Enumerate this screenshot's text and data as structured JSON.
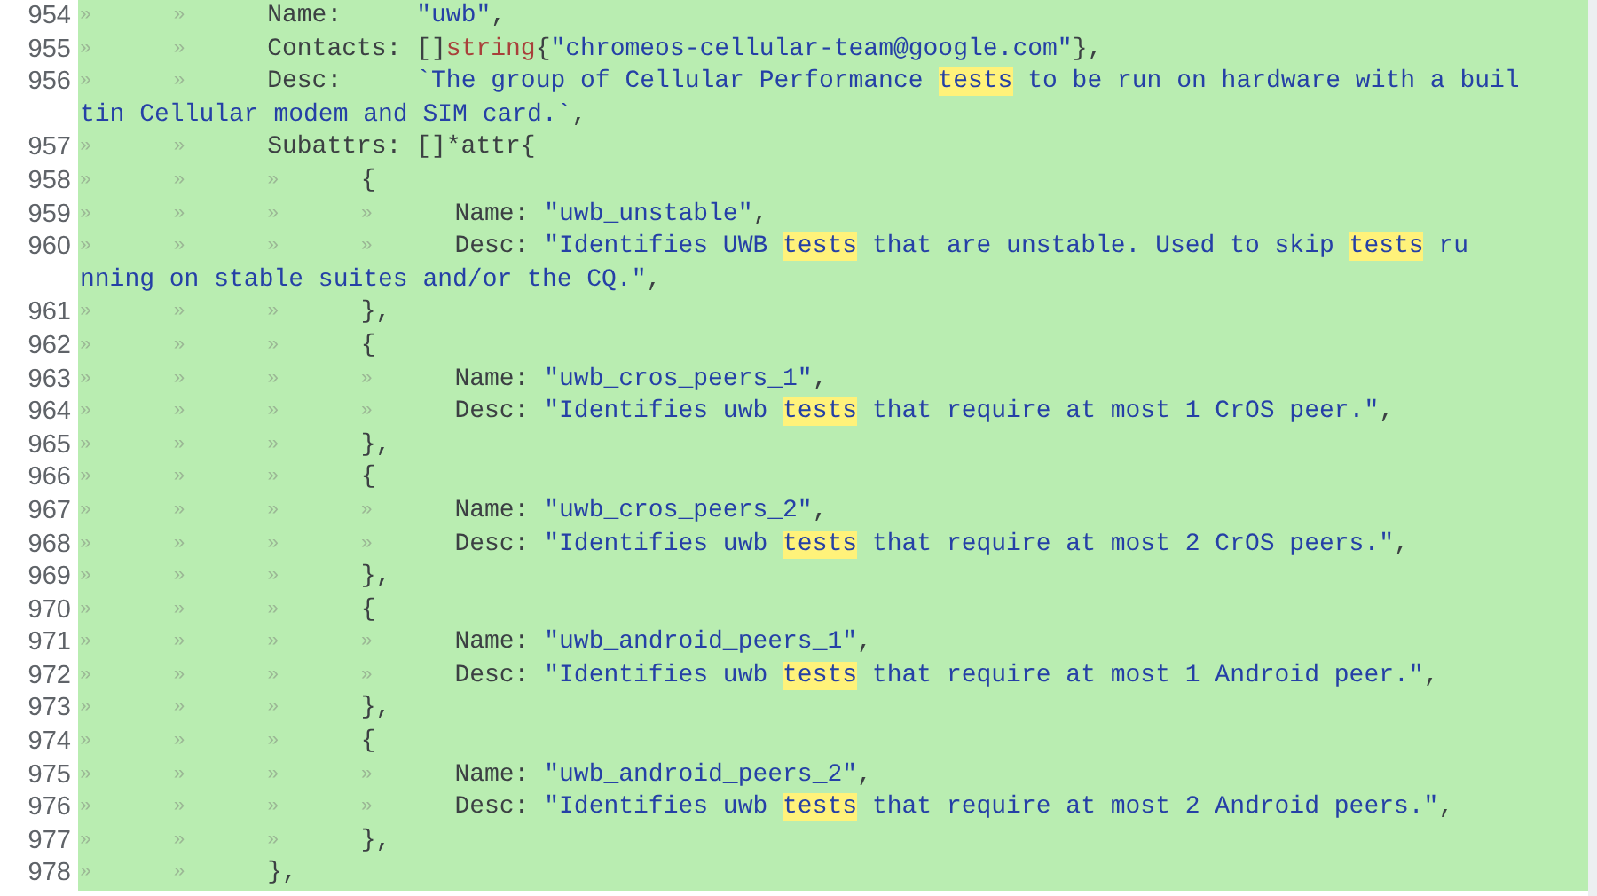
{
  "diff_lines": [
    {
      "number": "954",
      "indent": [
        "»",
        "»"
      ],
      "segments": [
        {
          "kind": "key",
          "text": "Name:     "
        },
        {
          "kind": "string",
          "text": "\"uwb\""
        },
        {
          "kind": "key",
          "text": ","
        }
      ]
    },
    {
      "number": "955",
      "indent": [
        "»",
        "»"
      ],
      "segments": [
        {
          "kind": "key",
          "text": "Contacts: []"
        },
        {
          "kind": "type",
          "text": "string"
        },
        {
          "kind": "key",
          "text": "{"
        },
        {
          "kind": "string",
          "text": "\"chromeos-cellular-team@google.com\""
        },
        {
          "kind": "key",
          "text": "},"
        }
      ]
    },
    {
      "number": "956",
      "indent": [
        "»",
        "»"
      ],
      "segments": [
        {
          "kind": "key",
          "text": "Desc:     "
        },
        {
          "kind": "string",
          "text": "`The group of Cellular Performance "
        },
        {
          "kind": "match",
          "text": "tests"
        },
        {
          "kind": "string",
          "text": " to be run on hardware with a buil"
        }
      ],
      "wrap": [
        {
          "kind": "string",
          "text": "tin Cellular modem and SIM card.`"
        },
        {
          "kind": "key",
          "text": ","
        }
      ]
    },
    {
      "number": "957",
      "indent": [
        "»",
        "»"
      ],
      "segments": [
        {
          "kind": "key",
          "text": "Subattrs: []*attr{"
        }
      ]
    },
    {
      "number": "958",
      "indent": [
        "»",
        "»",
        "»"
      ],
      "segments": [
        {
          "kind": "key",
          "text": "{"
        }
      ]
    },
    {
      "number": "959",
      "indent": [
        "»",
        "»",
        "»",
        "»"
      ],
      "segments": [
        {
          "kind": "key",
          "text": "Name: "
        },
        {
          "kind": "string",
          "text": "\"uwb_unstable\""
        },
        {
          "kind": "key",
          "text": ","
        }
      ]
    },
    {
      "number": "960",
      "indent": [
        "»",
        "»",
        "»",
        "»"
      ],
      "segments": [
        {
          "kind": "key",
          "text": "Desc: "
        },
        {
          "kind": "string",
          "text": "\"Identifies UWB "
        },
        {
          "kind": "match",
          "text": "tests"
        },
        {
          "kind": "string",
          "text": " that are unstable. Used to skip "
        },
        {
          "kind": "match",
          "text": "tests"
        },
        {
          "kind": "string",
          "text": " ru"
        }
      ],
      "wrap": [
        {
          "kind": "string",
          "text": "nning on stable suites and/or the CQ.\""
        },
        {
          "kind": "key",
          "text": ","
        }
      ]
    },
    {
      "number": "961",
      "indent": [
        "»",
        "»",
        "»"
      ],
      "segments": [
        {
          "kind": "key",
          "text": "},"
        }
      ]
    },
    {
      "number": "962",
      "indent": [
        "»",
        "»",
        "»"
      ],
      "segments": [
        {
          "kind": "key",
          "text": "{"
        }
      ]
    },
    {
      "number": "963",
      "indent": [
        "»",
        "»",
        "»",
        "»"
      ],
      "segments": [
        {
          "kind": "key",
          "text": "Name: "
        },
        {
          "kind": "string",
          "text": "\"uwb_cros_peers_1\""
        },
        {
          "kind": "key",
          "text": ","
        }
      ]
    },
    {
      "number": "964",
      "indent": [
        "»",
        "»",
        "»",
        "»"
      ],
      "segments": [
        {
          "kind": "key",
          "text": "Desc: "
        },
        {
          "kind": "string",
          "text": "\"Identifies uwb "
        },
        {
          "kind": "match",
          "text": "tests"
        },
        {
          "kind": "string",
          "text": " that require at most 1 CrOS peer.\""
        },
        {
          "kind": "key",
          "text": ","
        }
      ]
    },
    {
      "number": "965",
      "indent": [
        "»",
        "»",
        "»"
      ],
      "segments": [
        {
          "kind": "key",
          "text": "},"
        }
      ]
    },
    {
      "number": "966",
      "indent": [
        "»",
        "»",
        "»"
      ],
      "segments": [
        {
          "kind": "key",
          "text": "{"
        }
      ]
    },
    {
      "number": "967",
      "indent": [
        "»",
        "»",
        "»",
        "»"
      ],
      "segments": [
        {
          "kind": "key",
          "text": "Name: "
        },
        {
          "kind": "string",
          "text": "\"uwb_cros_peers_2\""
        },
        {
          "kind": "key",
          "text": ","
        }
      ]
    },
    {
      "number": "968",
      "indent": [
        "»",
        "»",
        "»",
        "»"
      ],
      "segments": [
        {
          "kind": "key",
          "text": "Desc: "
        },
        {
          "kind": "string",
          "text": "\"Identifies uwb "
        },
        {
          "kind": "match",
          "text": "tests"
        },
        {
          "kind": "string",
          "text": " that require at most 2 CrOS peers.\""
        },
        {
          "kind": "key",
          "text": ","
        }
      ]
    },
    {
      "number": "969",
      "indent": [
        "»",
        "»",
        "»"
      ],
      "segments": [
        {
          "kind": "key",
          "text": "},"
        }
      ]
    },
    {
      "number": "970",
      "indent": [
        "»",
        "»",
        "»"
      ],
      "segments": [
        {
          "kind": "key",
          "text": "{"
        }
      ]
    },
    {
      "number": "971",
      "indent": [
        "»",
        "»",
        "»",
        "»"
      ],
      "segments": [
        {
          "kind": "key",
          "text": "Name: "
        },
        {
          "kind": "string",
          "text": "\"uwb_android_peers_1\""
        },
        {
          "kind": "key",
          "text": ","
        }
      ]
    },
    {
      "number": "972",
      "indent": [
        "»",
        "»",
        "»",
        "»"
      ],
      "segments": [
        {
          "kind": "key",
          "text": "Desc: "
        },
        {
          "kind": "string",
          "text": "\"Identifies uwb "
        },
        {
          "kind": "match",
          "text": "tests"
        },
        {
          "kind": "string",
          "text": " that require at most 1 Android peer.\""
        },
        {
          "kind": "key",
          "text": ","
        }
      ]
    },
    {
      "number": "973",
      "indent": [
        "»",
        "»",
        "»"
      ],
      "segments": [
        {
          "kind": "key",
          "text": "},"
        }
      ]
    },
    {
      "number": "974",
      "indent": [
        "»",
        "»",
        "»"
      ],
      "segments": [
        {
          "kind": "key",
          "text": "{"
        }
      ]
    },
    {
      "number": "975",
      "indent": [
        "»",
        "»",
        "»",
        "»"
      ],
      "segments": [
        {
          "kind": "key",
          "text": "Name: "
        },
        {
          "kind": "string",
          "text": "\"uwb_android_peers_2\""
        },
        {
          "kind": "key",
          "text": ","
        }
      ]
    },
    {
      "number": "976",
      "indent": [
        "»",
        "»",
        "»",
        "»"
      ],
      "segments": [
        {
          "kind": "key",
          "text": "Desc: "
        },
        {
          "kind": "string",
          "text": "\"Identifies uwb "
        },
        {
          "kind": "match",
          "text": "tests"
        },
        {
          "kind": "string",
          "text": " that require at most 2 Android peers.\""
        },
        {
          "kind": "key",
          "text": ","
        }
      ]
    },
    {
      "number": "977",
      "indent": [
        "»",
        "»",
        "»"
      ],
      "segments": [
        {
          "kind": "key",
          "text": "},"
        }
      ]
    },
    {
      "number": "978",
      "indent": [
        "»",
        "»"
      ],
      "segments": [
        {
          "kind": "key",
          "text": "},"
        }
      ]
    }
  ]
}
